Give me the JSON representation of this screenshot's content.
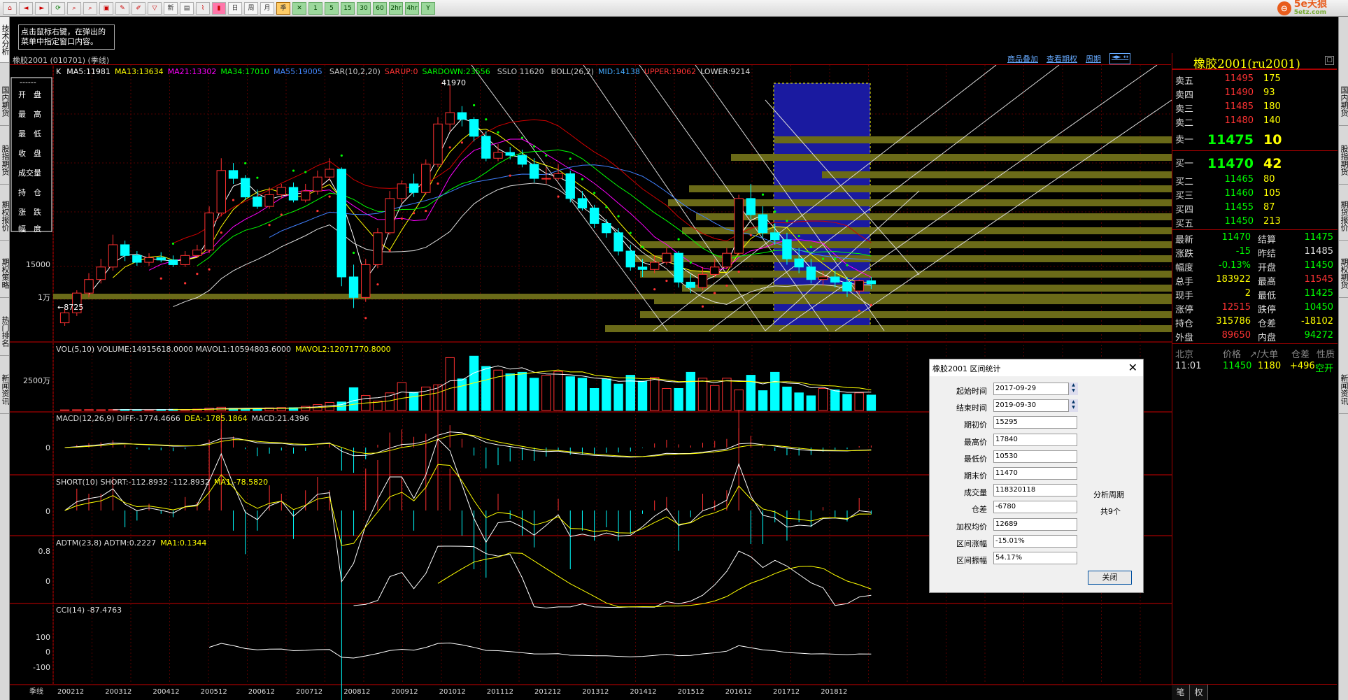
{
  "toolbar": {
    "buttons": [
      "home",
      "back",
      "fwd",
      "refresh",
      "find",
      "find2",
      "window",
      "tools",
      "draw",
      "config",
      "new",
      "table",
      "kline",
      "1tick",
      "cal",
      "day",
      "week",
      "month",
      "season",
      "x",
      "1",
      "5",
      "15",
      "30",
      "60",
      "2hr",
      "4hr",
      "y"
    ],
    "timeframe_labels": [
      "1",
      "5",
      "15",
      "30",
      "60",
      "2hr",
      "4hr",
      "Y"
    ],
    "day_label": "日",
    "week_label": "周",
    "month_label": "月",
    "season_label": "季",
    "new_label": "新"
  },
  "logo": {
    "mark": "⊖",
    "name": "5e天狼",
    "domain": "5etz.com"
  },
  "left_tabs": [
    "技术分析",
    "国内期货",
    "股指期货",
    "期权报价",
    "期权策略",
    "热门排名",
    "新闻资讯"
  ],
  "right_tabs": [
    "国内期货",
    "股指期货",
    "期货报价",
    "期权期货",
    "新闻资讯"
  ],
  "tip": "点击鼠标右键，在弹出的菜单中指定窗口内容。",
  "title": "橡胶2001 (010701) (季线)",
  "title_links": [
    "商品叠加",
    "查看期权",
    "周期"
  ],
  "quote_title": "橡胶2001(ru2001)",
  "indicators": {
    "main": {
      "k": "K",
      "ma5": "MA5:11981",
      "ma13": "MA13:13634",
      "ma21": "MA21:13302",
      "ma34": "MA34:17010",
      "ma55": "MA55:19005",
      "sar": "SAR(10,2,20)",
      "sarup": "SARUP:0",
      "sardown": "SARDOWN:23556",
      "sslo": "SSLO 11620",
      "boll": "BOLL(26,2)",
      "mid": "MID:14138",
      "upper": "UPPER:19062",
      "lower": "LOWER:9214"
    },
    "vol": {
      "a": "VOL(5,10) VOLUME:14915618.0000 MAVOL1:10594803.6000",
      "b": "MAVOL2:12071770.8000"
    },
    "macd": {
      "a": "MACD(12,26,9) DIFF:-1774.4666",
      "b": "DEA:-1785.1864",
      "c": "MACD:21.4396"
    },
    "short": {
      "a": "SHORT(10) SHORT:-112.8932 -112.8932",
      "b": "MA1:-78.5820"
    },
    "adtm": {
      "a": "ADTM(23,8) ADTM:0.2227",
      "b": "MA1:0.1344"
    },
    "cci": {
      "a": "CCI(14) -87.4763"
    }
  },
  "left_menu": [
    "开　盘",
    "最　高",
    "最　低",
    "收　盘",
    "成交量",
    "持　仓",
    "涨　跌",
    "幅　度"
  ],
  "left_menu_top": "------",
  "axis": {
    "main": [
      "15000",
      "1万"
    ],
    "vol": [
      "2500万"
    ],
    "macd": [
      "0"
    ],
    "short": [
      "0"
    ],
    "adtm": [
      "0.8",
      "0"
    ],
    "cci": [
      "100",
      "0",
      "-100"
    ],
    "xlabels": [
      "季线",
      "200212",
      "200312",
      "200412",
      "200512",
      "200612",
      "200712",
      "200812",
      "200912",
      "201012",
      "201112",
      "201212",
      "201312",
      "201412",
      "201512",
      "201612",
      "201712",
      "201812"
    ]
  },
  "chart_notes": {
    "high": "41970",
    "low": "←8725"
  },
  "colors": {
    "up": "#ff3030",
    "down": "#00ffff",
    "ma5": "#ffffff",
    "ma13": "#ffff00",
    "ma21": "#ff00ff",
    "ma34": "#00ff00",
    "ma55": "#4080ff",
    "boll_mid": "#a0a0a0",
    "boll_upper": "#d00000",
    "label_green": "#00ff00",
    "label_yellow": "#ffff00"
  },
  "chart_data": {
    "type": "candlestick",
    "periods": [
      "2002Q4",
      "2003Q1",
      "2003Q2",
      "2003Q3",
      "2003Q4",
      "2004Q1",
      "2004Q2",
      "2004Q3",
      "2004Q4",
      "2005Q1",
      "2005Q2",
      "2005Q3",
      "2005Q4",
      "2006Q1",
      "2006Q2",
      "2006Q3",
      "2006Q4",
      "2007Q1",
      "2007Q2",
      "2007Q3",
      "2007Q4",
      "2008Q1",
      "2008Q2",
      "2008Q3",
      "2008Q4",
      "2009Q1",
      "2009Q2",
      "2009Q3",
      "2009Q4",
      "2010Q1",
      "2010Q2",
      "2010Q3",
      "2010Q4",
      "2011Q1",
      "2011Q2",
      "2011Q3",
      "2011Q4",
      "2012Q1",
      "2012Q2",
      "2012Q3",
      "2012Q4",
      "2013Q1",
      "2013Q2",
      "2013Q3",
      "2013Q4",
      "2014Q1",
      "2014Q2",
      "2014Q3",
      "2014Q4",
      "2015Q1",
      "2015Q2",
      "2015Q3",
      "2015Q4",
      "2016Q1",
      "2016Q2",
      "2016Q3",
      "2016Q4",
      "2017Q1",
      "2017Q2",
      "2017Q3",
      "2017Q4",
      "2018Q1",
      "2018Q2",
      "2018Q3",
      "2018Q4",
      "2019Q1",
      "2019Q2",
      "2019Q3"
    ],
    "open": [
      8900,
      9500,
      10800,
      11800,
      12800,
      14800,
      13800,
      13200,
      13600,
      13400,
      13000,
      13800,
      14300,
      18200,
      24000,
      22800,
      20200,
      19000,
      20500,
      21500,
      19800,
      21000,
      23000,
      24200,
      12000,
      10500,
      13000,
      16000,
      20000,
      22000,
      20800,
      25000,
      32500,
      35000,
      33500,
      30000,
      26000,
      27000,
      26500,
      25000,
      22800,
      22800,
      23500,
      20000,
      18800,
      17000,
      16000,
      14200,
      12800,
      12600,
      13200,
      14000,
      11600,
      11200,
      12200,
      12800,
      14000,
      20000,
      18000,
      16000,
      15295,
      13500,
      12800,
      11800,
      12000,
      11600,
      10950,
      11700
    ],
    "close": [
      9500,
      10800,
      11800,
      12800,
      14800,
      13800,
      13200,
      13600,
      13400,
      13000,
      13800,
      14300,
      18200,
      24000,
      22800,
      20200,
      19000,
      20500,
      21500,
      19800,
      21000,
      23000,
      24200,
      12000,
      10500,
      13000,
      16000,
      20000,
      22000,
      20800,
      25000,
      32500,
      35000,
      33500,
      30000,
      26000,
      27000,
      26500,
      25000,
      22800,
      22800,
      23500,
      20000,
      18800,
      17000,
      16000,
      14200,
      12800,
      12600,
      13200,
      14000,
      11600,
      11200,
      12200,
      12800,
      14000,
      20000,
      18000,
      16000,
      15295,
      13500,
      12800,
      11800,
      12000,
      11600,
      10950,
      11700,
      11470
    ],
    "high": [
      9800,
      11000,
      12300,
      13500,
      15800,
      15200,
      14200,
      14000,
      14100,
      13800,
      14200,
      14800,
      19000,
      26000,
      25200,
      23300,
      21200,
      21500,
      22000,
      22200,
      22000,
      24000,
      26000,
      24500,
      13000,
      13500,
      16500,
      21000,
      22500,
      23500,
      25800,
      34000,
      41970,
      36500,
      34000,
      31000,
      28500,
      28000,
      27500,
      26000,
      24500,
      25000,
      24000,
      21000,
      19200,
      17500,
      16500,
      14800,
      13500,
      13800,
      14500,
      14200,
      12200,
      12800,
      13500,
      14500,
      20500,
      22000,
      19000,
      17000,
      16000,
      14500,
      13500,
      12500,
      12500,
      12000,
      11800,
      12000
    ],
    "low": [
      8725,
      9300,
      10500,
      11500,
      12500,
      13300,
      12900,
      12900,
      13200,
      12800,
      12800,
      13600,
      14000,
      17800,
      22000,
      19800,
      18700,
      18700,
      20000,
      19500,
      19500,
      20500,
      22500,
      11300,
      9800,
      10200,
      12700,
      15800,
      19500,
      20200,
      20500,
      24500,
      31000,
      32000,
      29000,
      25500,
      25500,
      25800,
      24500,
      22200,
      22000,
      22500,
      19500,
      18500,
      16500,
      15500,
      13800,
      12500,
      12000,
      12300,
      13000,
      11200,
      10800,
      11000,
      12000,
      12600,
      13800,
      17500,
      15500,
      14800,
      13000,
      12300,
      11500,
      11300,
      11200,
      10530,
      10700,
      11100
    ],
    "volume": [
      0.4,
      0.5,
      0.6,
      0.5,
      0.6,
      0.7,
      0.6,
      0.5,
      0.7,
      0.8,
      0.7,
      0.9,
      1.6,
      2.2,
      1.5,
      1.4,
      1.5,
      1.8,
      2.0,
      1.9,
      2.8,
      4.0,
      5.5,
      5.8,
      15.5,
      10.2,
      6.4,
      12.0,
      19.0,
      12.5,
      16.0,
      17.5,
      36.0,
      21.5,
      37.0,
      30.0,
      27.5,
      25.0,
      26.0,
      22.0,
      24.0,
      26.5,
      23.0,
      22.0,
      15.0,
      21.5,
      18.0,
      24.0,
      20.0,
      22.5,
      15.0,
      15.0,
      26.0,
      22.0,
      17.0,
      22.0,
      14.0,
      24.0,
      13.5,
      26.0,
      16.0,
      12.0,
      10.0,
      15.0,
      14.0,
      11.0,
      12.0,
      10.5
    ],
    "high_label": 41970,
    "low_label": 8725,
    "ylim": [
      8000,
      42000
    ],
    "selected_range": [
      "2017-09-29",
      "2019-09-30"
    ]
  },
  "quote": {
    "asks": [
      {
        "label": "卖五",
        "price": "11495",
        "vol": "175"
      },
      {
        "label": "卖四",
        "price": "11490",
        "vol": "93"
      },
      {
        "label": "卖三",
        "price": "11485",
        "vol": "180"
      },
      {
        "label": "卖二",
        "price": "11480",
        "vol": "140"
      }
    ],
    "ask1": {
      "label": "卖一",
      "price": "11475",
      "vol": "10"
    },
    "bid1": {
      "label": "买一",
      "price": "11470",
      "vol": "42"
    },
    "bids": [
      {
        "label": "买二",
        "price": "11465",
        "vol": "80"
      },
      {
        "label": "买三",
        "price": "11460",
        "vol": "105"
      },
      {
        "label": "买四",
        "price": "11455",
        "vol": "87"
      },
      {
        "label": "买五",
        "price": "11450",
        "vol": "213"
      }
    ],
    "stats": [
      {
        "l1": "最新",
        "v1": "11470",
        "l2": "结算",
        "v2": "11475"
      },
      {
        "l1": "涨跌",
        "v1": "-15",
        "l2": "昨结",
        "v2": "11485"
      },
      {
        "l1": "幅度",
        "v1": "-0.13%",
        "l2": "开盘",
        "v2": "11450"
      },
      {
        "l1": "总手",
        "v1": "183922",
        "l2": "最高",
        "v2": "11545"
      },
      {
        "l1": "现手",
        "v1": "2",
        "l2": "最低",
        "v2": "11425"
      },
      {
        "l1": "涨停",
        "v1": "12515",
        "l2": "跌停",
        "v2": "10450"
      },
      {
        "l1": "持仓",
        "v1": "315786",
        "l2": "仓差",
        "v2": "-18102"
      },
      {
        "l1": "外盘",
        "v1": "89650",
        "l2": "内盘",
        "v2": "94272"
      }
    ],
    "tick_header": [
      "北京",
      "价格",
      "↗/大单",
      "仓差",
      "性质"
    ],
    "tick": {
      "time": "11:01",
      "price": "11450",
      "vol": "1180",
      "diff": "+496",
      "kind": "空开"
    }
  },
  "dialog": {
    "title": "橡胶2001 区间统计",
    "close": "✕",
    "fields": [
      {
        "label": "起始时间",
        "value": "2017-09-29"
      },
      {
        "label": "结束时间",
        "value": "2019-09-30"
      },
      {
        "label": "期初价",
        "value": "15295"
      },
      {
        "label": "最高价",
        "value": "17840"
      },
      {
        "label": "最低价",
        "value": "10530"
      },
      {
        "label": "期末价",
        "value": "11470"
      },
      {
        "label": "成交量",
        "value": "118320118"
      },
      {
        "label": "仓差",
        "value": "-6780"
      },
      {
        "label": "加权均价",
        "value": "12689"
      },
      {
        "label": "区间涨幅",
        "value": "-15.01%"
      },
      {
        "label": "区间振幅",
        "value": "54.17%"
      }
    ],
    "period_label": "分析周期",
    "period_count": "共9个",
    "button": "关闭"
  },
  "bottom_tabs": [
    "笔",
    "权"
  ]
}
